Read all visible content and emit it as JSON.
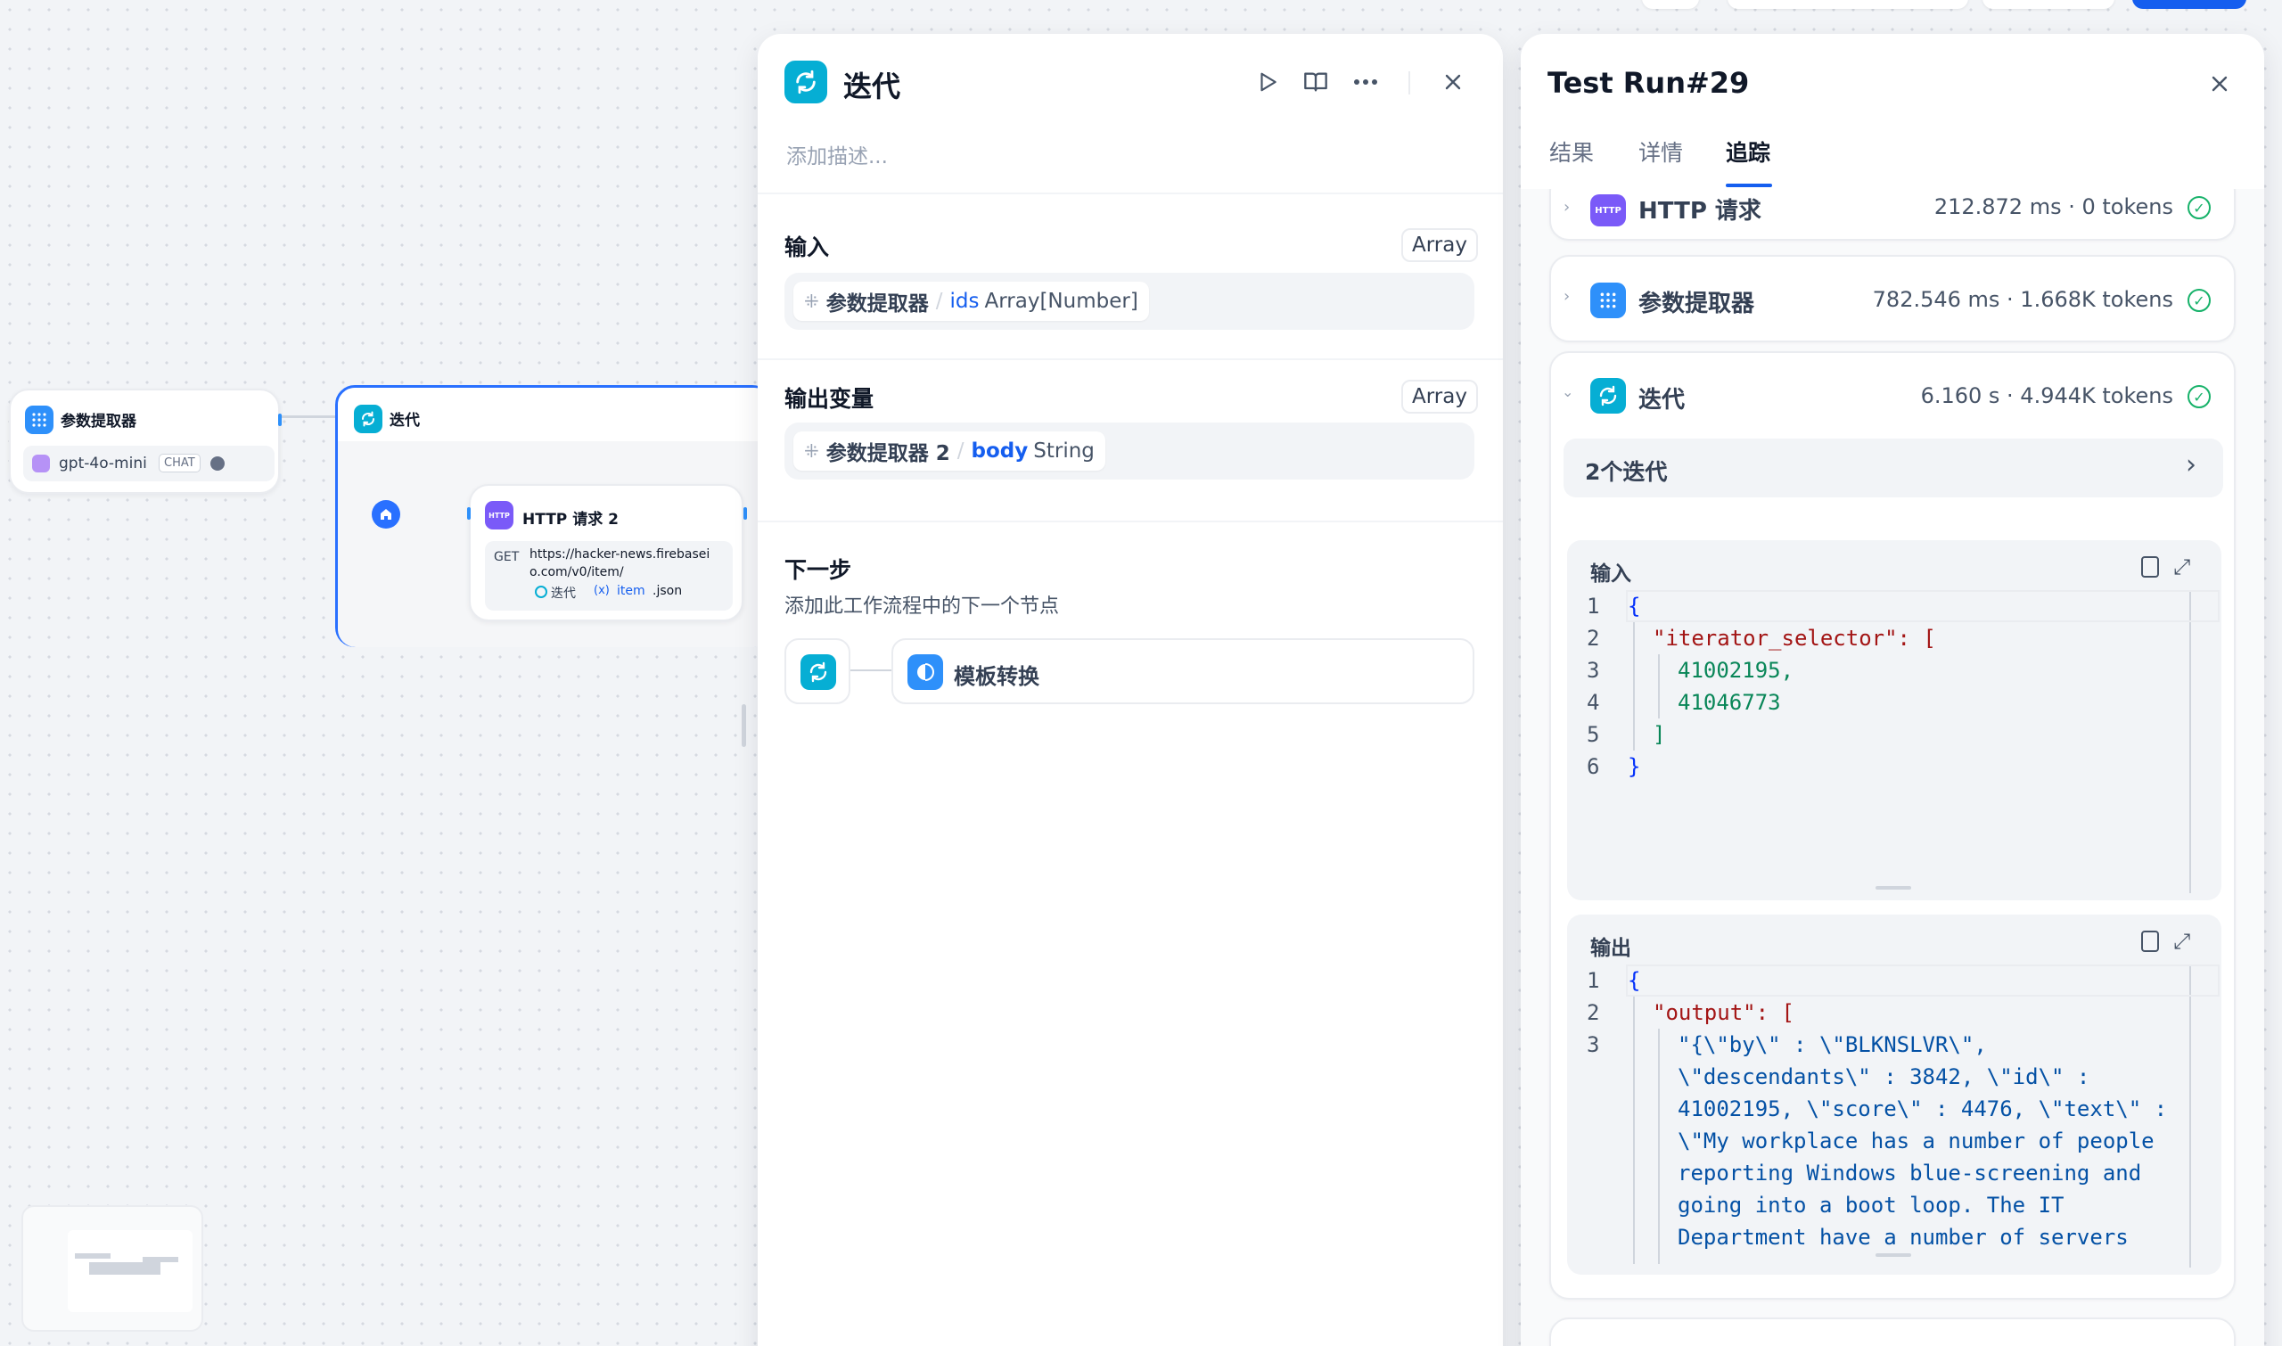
{
  "canvas": {
    "param_node": {
      "title": "参数提取器",
      "model": "gpt-4o-mini",
      "badge": "CHAT"
    },
    "iteration_node": {
      "title": "迭代"
    },
    "http_node": {
      "title": "HTTP 请求 2",
      "method": "GET",
      "url_line1": "https://hacker-news.firebasei",
      "url_line2": "o.com/v0/item/",
      "var_node": "迭代",
      "var_name": "item",
      "var_suffix": ".json"
    }
  },
  "node_panel": {
    "title": "迭代",
    "description_placeholder": "添加描述...",
    "input": {
      "label": "输入",
      "type": "Array",
      "var": {
        "node": "参数提取器",
        "name": "ids",
        "type": "Array[Number]"
      }
    },
    "output": {
      "label": "输出变量",
      "type": "Array",
      "var": {
        "node": "参数提取器 2",
        "name": "body",
        "type": "String"
      }
    },
    "next": {
      "title": "下一步",
      "subtitle": "添加此工作流程中的下一个节点",
      "node_label": "模板转换"
    }
  },
  "run_panel": {
    "title": "Test Run#29",
    "tabs": [
      {
        "label": "结果",
        "active": false
      },
      {
        "label": "详情",
        "active": false
      },
      {
        "label": "追踪",
        "active": true
      }
    ],
    "traces": [
      {
        "title": "HTTP 请求",
        "meta": "212.872 ms · 0 tokens",
        "icon": "http-icon"
      },
      {
        "title": "参数提取器",
        "meta": "782.546 ms · 1.668K tokens",
        "icon": "grid-icon"
      },
      {
        "title": "迭代",
        "meta": "6.160 s · 4.944K tokens",
        "icon": "loop-icon"
      }
    ],
    "iterations_label": "2个迭代",
    "input_label": "输入",
    "output_label": "输出",
    "input_code": [
      {
        "ln": "1",
        "text": "{"
      },
      {
        "ln": "2",
        "text": "\"iterator_selector\": ["
      },
      {
        "ln": "3",
        "text": "41002195,"
      },
      {
        "ln": "4",
        "text": "41046773"
      },
      {
        "ln": "5",
        "text": "]"
      },
      {
        "ln": "6",
        "text": "}"
      }
    ],
    "output_code": [
      {
        "ln": "1",
        "text": "{"
      },
      {
        "ln": "2",
        "text": "\"output\": ["
      },
      {
        "ln": "3",
        "text": "\"{\\\"by\\\" : \\\"BLKNSLVR\\\","
      },
      {
        "ln": "",
        "text": "\\\"descendants\\\" : 3842, \\\"id\\\" :"
      },
      {
        "ln": "",
        "text": "41002195, \\\"score\\\" : 4476, \\\"text\\\" :"
      },
      {
        "ln": "",
        "text": "\\\"My workplace has a number of people"
      },
      {
        "ln": "",
        "text": "reporting Windows blue-screening and"
      },
      {
        "ln": "",
        "text": "going into a boot loop. The IT"
      },
      {
        "ln": "",
        "text": "Department have a number of servers"
      }
    ]
  }
}
